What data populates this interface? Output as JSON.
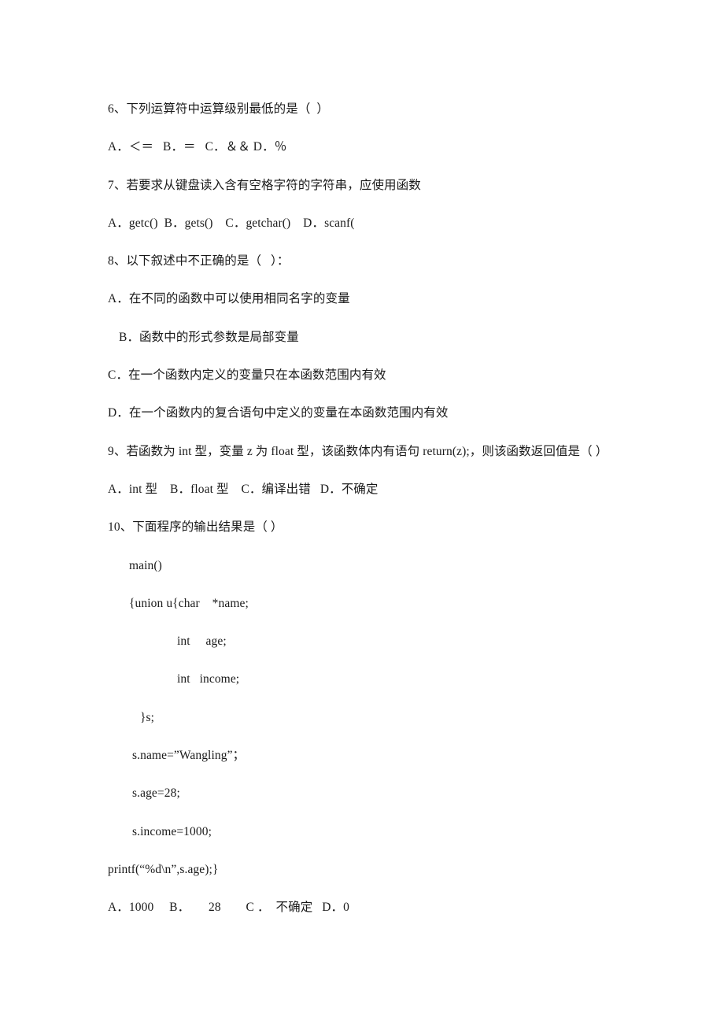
{
  "document": {
    "kind": "exam-paper",
    "language": "zh-CN",
    "background_color": "#ffffff",
    "text_color": "#1a1a1a"
  },
  "questions": [
    {
      "number": "6",
      "stem": "6、下列运算符中运算级别最低的是（  ）",
      "options_line": "A．＜＝   B．＝   C．＆＆ D．％"
    },
    {
      "number": "7",
      "stem": "7、若要求从键盘读入含有空格字符的字符串，应使用函数",
      "options_line": "A．getc()  B．gets()    C．getchar()    D．scanf("
    },
    {
      "number": "8",
      "stem": "8、以下叙述中不正确的是（   ）：",
      "option_a": "A．在不同的函数中可以使用相同名字的变量",
      "option_b": "B．函数中的形式参数是局部变量",
      "option_c": "C．在一个函数内定义的变量只在本函数范围内有效",
      "option_d": "D．在一个函数内的复合语句中定义的变量在本函数范围内有效"
    },
    {
      "number": "9",
      "stem": "9、若函数为 int 型，变量 z 为 float 型，该函数体内有语句 return(z);，则该函数返回值是（ ）",
      "options_line": "A．int 型    B．float 型    C．编译出错   D．不确定"
    },
    {
      "number": "10",
      "stem": "10、下面程序的输出结果是（ ）",
      "options_line": "A．1000     B．      28        C ．  不确定   D．0"
    }
  ],
  "code_listing": {
    "lines": [
      "main()",
      "{union u{char    *name;",
      "int     age;",
      "int   income;",
      "}s;",
      "s.name=”Wangling”；",
      "s.age=28;",
      "s.income=1000;",
      "printf(“%d\\n”,s.age);}"
    ]
  }
}
